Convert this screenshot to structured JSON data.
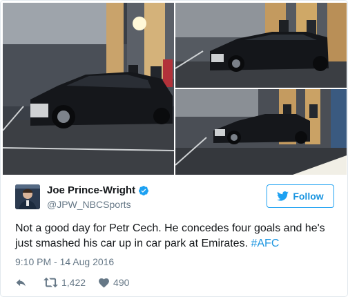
{
  "tweet": {
    "display_name": "Joe Prince-Wright",
    "handle": "@JPW_NBCSports",
    "follow_label": "Follow",
    "text_main": "Not a good day for Petr Cech. He concedes four goals and he's just smashed his car up in car park at Emirates.",
    "hashtag": "#AFC",
    "timestamp": "9:10 PM - 14 Aug 2016",
    "retweets": "1,422",
    "likes": "490"
  },
  "colors": {
    "link": "#1b95e0",
    "verified": "#1da1f2",
    "muted": "#657786"
  },
  "icons": [
    "verified-badge-icon",
    "twitter-bird-icon",
    "reply-icon",
    "retweet-icon",
    "heart-icon"
  ],
  "media": {
    "photos": [
      "car-photo-main",
      "car-photo-top-right",
      "car-photo-bottom-right"
    ]
  }
}
